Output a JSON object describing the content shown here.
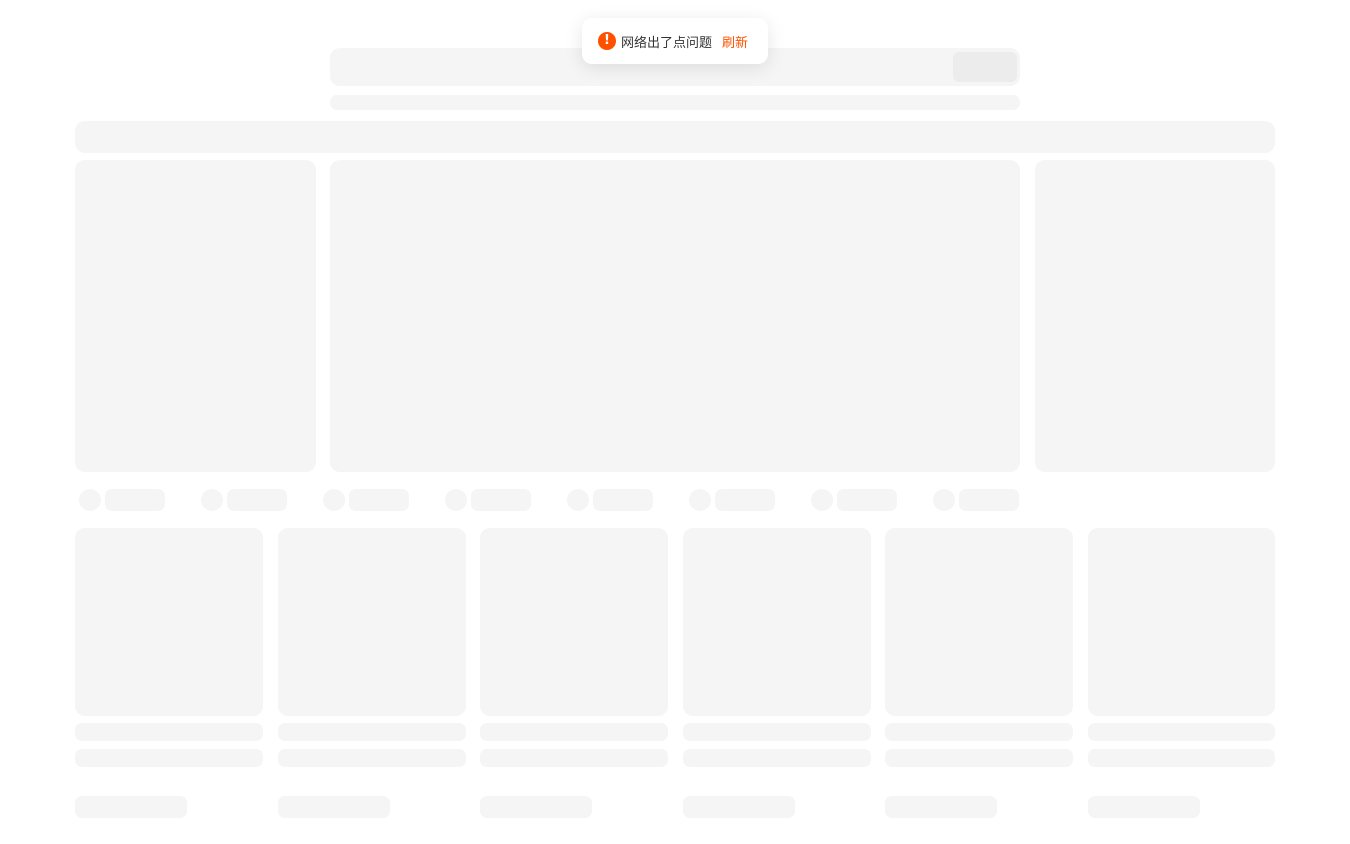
{
  "toast": {
    "icon": "exclamation-icon",
    "icon_glyph": "!",
    "message": "网络出了点问题",
    "action_label": "刷新",
    "accent_color": "#ff5000"
  },
  "skeleton": {
    "color": "#f5f5f5",
    "category_count": 8,
    "product_card_count": 6
  }
}
